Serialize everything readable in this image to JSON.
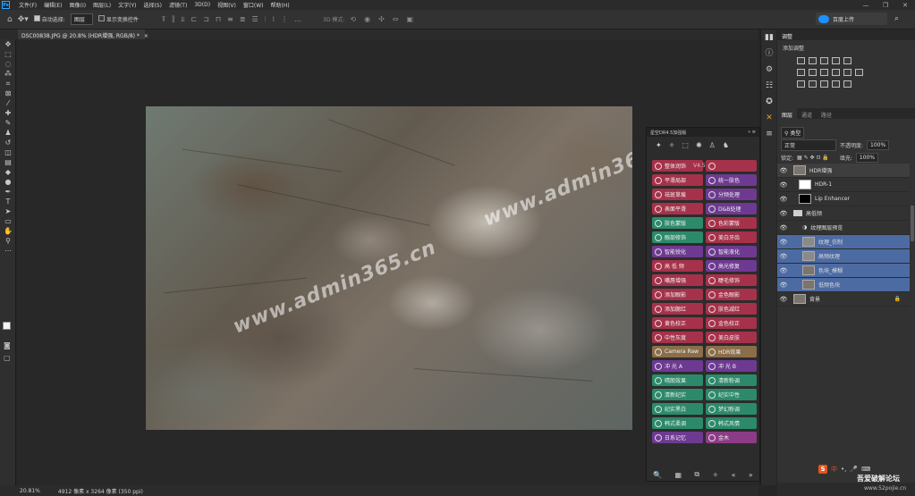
{
  "menubar": {
    "logo": "Ps",
    "items": [
      "文件(F)",
      "编辑(E)",
      "图像(I)",
      "图层(L)",
      "文字(Y)",
      "选择(S)",
      "滤镜(T)",
      "3D(D)",
      "视图(V)",
      "窗口(W)",
      "帮助(H)"
    ],
    "window_buttons": [
      "—",
      "❐",
      "✕"
    ]
  },
  "options": {
    "auto_select_label": "自动选择:",
    "auto_select_value": "图层",
    "show_transform_label": "显示变换控件",
    "mode_3d": "3D 模式:",
    "share_label": "百度上传"
  },
  "document": {
    "tab_title": "DSC00838.JPG @ 20.8% (HDR增强, RGB/8) *",
    "close": "×",
    "zoom": "20.81%",
    "size": "4912 像素 x 3264 像素 (350 ppi)"
  },
  "watermarks": [
    "www.admin365.cn",
    "www.admin365.cn"
  ],
  "plugin": {
    "title": "星空DR4.5加强版",
    "collapse": "»",
    "menu": "≡",
    "tool_icons": [
      "✦",
      "✧",
      "⬚",
      "✺",
      "♙",
      "♞"
    ],
    "version": "V4.5",
    "buttons": [
      [
        {
          "label": "整体润饰",
          "color": "red"
        },
        {
          "label": "",
          "color": "red"
        }
      ],
      [
        {
          "label": "平滑局部",
          "color": "red"
        },
        {
          "label": "统一肤色",
          "color": "purple"
        }
      ],
      [
        {
          "label": "祛斑草痕",
          "color": "red"
        },
        {
          "label": "分频处理",
          "color": "purple"
        }
      ],
      [
        {
          "label": "表面平滑",
          "color": "red"
        },
        {
          "label": "D&B处理",
          "color": "purple"
        }
      ],
      [
        {
          "label": "肤色蒙版",
          "color": "teal"
        },
        {
          "label": "色彩蒙版",
          "color": "red"
        }
      ],
      [
        {
          "label": "眼部修饰",
          "color": "teal"
        },
        {
          "label": "美白牙齿",
          "color": "red"
        }
      ],
      [
        {
          "label": "智能锐化",
          "color": "purple"
        },
        {
          "label": "智能液化",
          "color": "purple"
        }
      ],
      [
        {
          "label": "高 低 频",
          "color": "red"
        },
        {
          "label": "高光修复",
          "color": "purple"
        }
      ],
      [
        {
          "label": "嘴唇增强",
          "color": "red"
        },
        {
          "label": "睫毛修饰",
          "color": "red"
        }
      ],
      [
        {
          "label": "添加眼影",
          "color": "red"
        },
        {
          "label": "金色眼影",
          "color": "red"
        }
      ],
      [
        {
          "label": "添加腮红",
          "color": "red"
        },
        {
          "label": "肤色减红",
          "color": "red"
        }
      ],
      [
        {
          "label": "黄色校正",
          "color": "red"
        },
        {
          "label": "金色校正",
          "color": "red"
        }
      ],
      [
        {
          "label": "中性灰度",
          "color": "red"
        },
        {
          "label": "美白皮肤",
          "color": "red"
        }
      ],
      [
        {
          "label": "Camera Raw",
          "color": "brown"
        },
        {
          "label": "HDR效果",
          "color": "brown"
        }
      ],
      [
        {
          "label": "冲 光 A",
          "color": "purple"
        },
        {
          "label": "冲 光 B",
          "color": "purple"
        }
      ],
      [
        {
          "label": "晴朗效果",
          "color": "teal"
        },
        {
          "label": "清新粉调",
          "color": "teal"
        }
      ],
      [
        {
          "label": "清新纪实",
          "color": "teal"
        },
        {
          "label": "纪实中性",
          "color": "teal"
        }
      ],
      [
        {
          "label": "纪实黑白",
          "color": "teal"
        },
        {
          "label": "梦幻粉调",
          "color": "teal"
        }
      ],
      [
        {
          "label": "韩式柔调",
          "color": "teal"
        },
        {
          "label": "韩式风情",
          "color": "teal"
        }
      ],
      [
        {
          "label": "日系记忆",
          "color": "purple"
        },
        {
          "label": "金木",
          "color": "mag"
        }
      ]
    ],
    "footer_icons": [
      "🔍",
      "▦",
      "⧉",
      "✧",
      "«",
      "»"
    ]
  },
  "adjustments": {
    "title": "调整",
    "subtitle": "添加调整"
  },
  "layers_panel": {
    "tabs": [
      "图层",
      "通道",
      "路径"
    ],
    "kind_label": "类型",
    "blend_mode": "正常",
    "opacity_label": "不透明度:",
    "opacity_value": "100%",
    "lock_label": "锁定:",
    "fill_label": "填充:",
    "fill_value": "100%",
    "layers": [
      {
        "name": "HDR增强",
        "thumb": "photo",
        "selected": true
      },
      {
        "name": "HDR-1",
        "thumb": "white",
        "selected": false
      },
      {
        "name": "Lip Enhancer",
        "thumb": "black",
        "selected": false
      },
      {
        "name": "高低频",
        "thumb": "folder",
        "selected": false
      },
      {
        "name": "纹理图层预览",
        "thumb": "none",
        "selected": false
      },
      {
        "name": "纹理_仿制",
        "thumb": "gray",
        "selected": true
      },
      {
        "name": "高频纹理",
        "thumb": "gray",
        "selected": true
      },
      {
        "name": "色块_模糊",
        "thumb": "photo",
        "selected": true
      },
      {
        "name": "低频色块",
        "thumb": "photo",
        "selected": true
      },
      {
        "name": "背景",
        "thumb": "photo",
        "selected": false
      }
    ]
  },
  "taskbar": {
    "ime": "中",
    "forum": "吾爱破解论坛",
    "forum_url": "www.52pojie.cn"
  },
  "colors": {
    "accent": "#31a8ff",
    "panel": "#323232",
    "selected": "#4d6ba3"
  }
}
